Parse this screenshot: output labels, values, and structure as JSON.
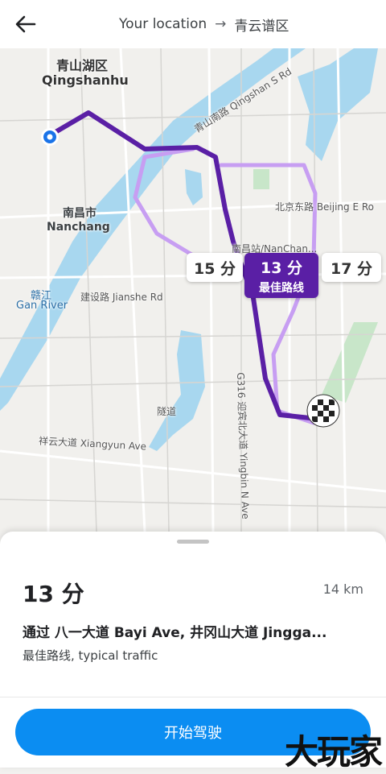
{
  "header": {
    "back_icon": "arrow-left-icon",
    "origin": "Your location",
    "arrow": "→",
    "destination": "青云谱区"
  },
  "map": {
    "labels": {
      "qingshanhu_cn": "青山湖区",
      "qingshanhu_en": "Qingshanhu",
      "nanchang_cn": "南昌市",
      "nanchang_en": "Nanchang",
      "ganjiang_cn": "赣江",
      "ganjiang_en": "Gan River",
      "jianshe": "建设路 Jianshe Rd",
      "xiangyun": "祥云大道 Xiangyun Ave",
      "beijing": "北京东路 Beijing E Ro",
      "qingshan_s": "青山南路 Qingshan S Rd",
      "nanchang_station": "南昌站/NanChan...",
      "suidao": "隧道",
      "yingbin": "G316 迎宾北大道 Yingbin N Ave"
    },
    "route_options": [
      {
        "time": "15 分"
      },
      {
        "time": "13 分",
        "tag": "最佳路线"
      },
      {
        "time": "17 分"
      }
    ],
    "colors": {
      "best_route": "#5a1fa5",
      "alt_route": "#c79ef2",
      "water": "#a8d7ef"
    }
  },
  "summary": {
    "duration": "13 分",
    "distance": "14 km",
    "via": "通过 八一大道 Bayi Ave, 井冈山大道 Jingga...",
    "traffic": "最佳路线, typical traffic"
  },
  "start_button": "开始驾驶",
  "watermark": "大玩家"
}
